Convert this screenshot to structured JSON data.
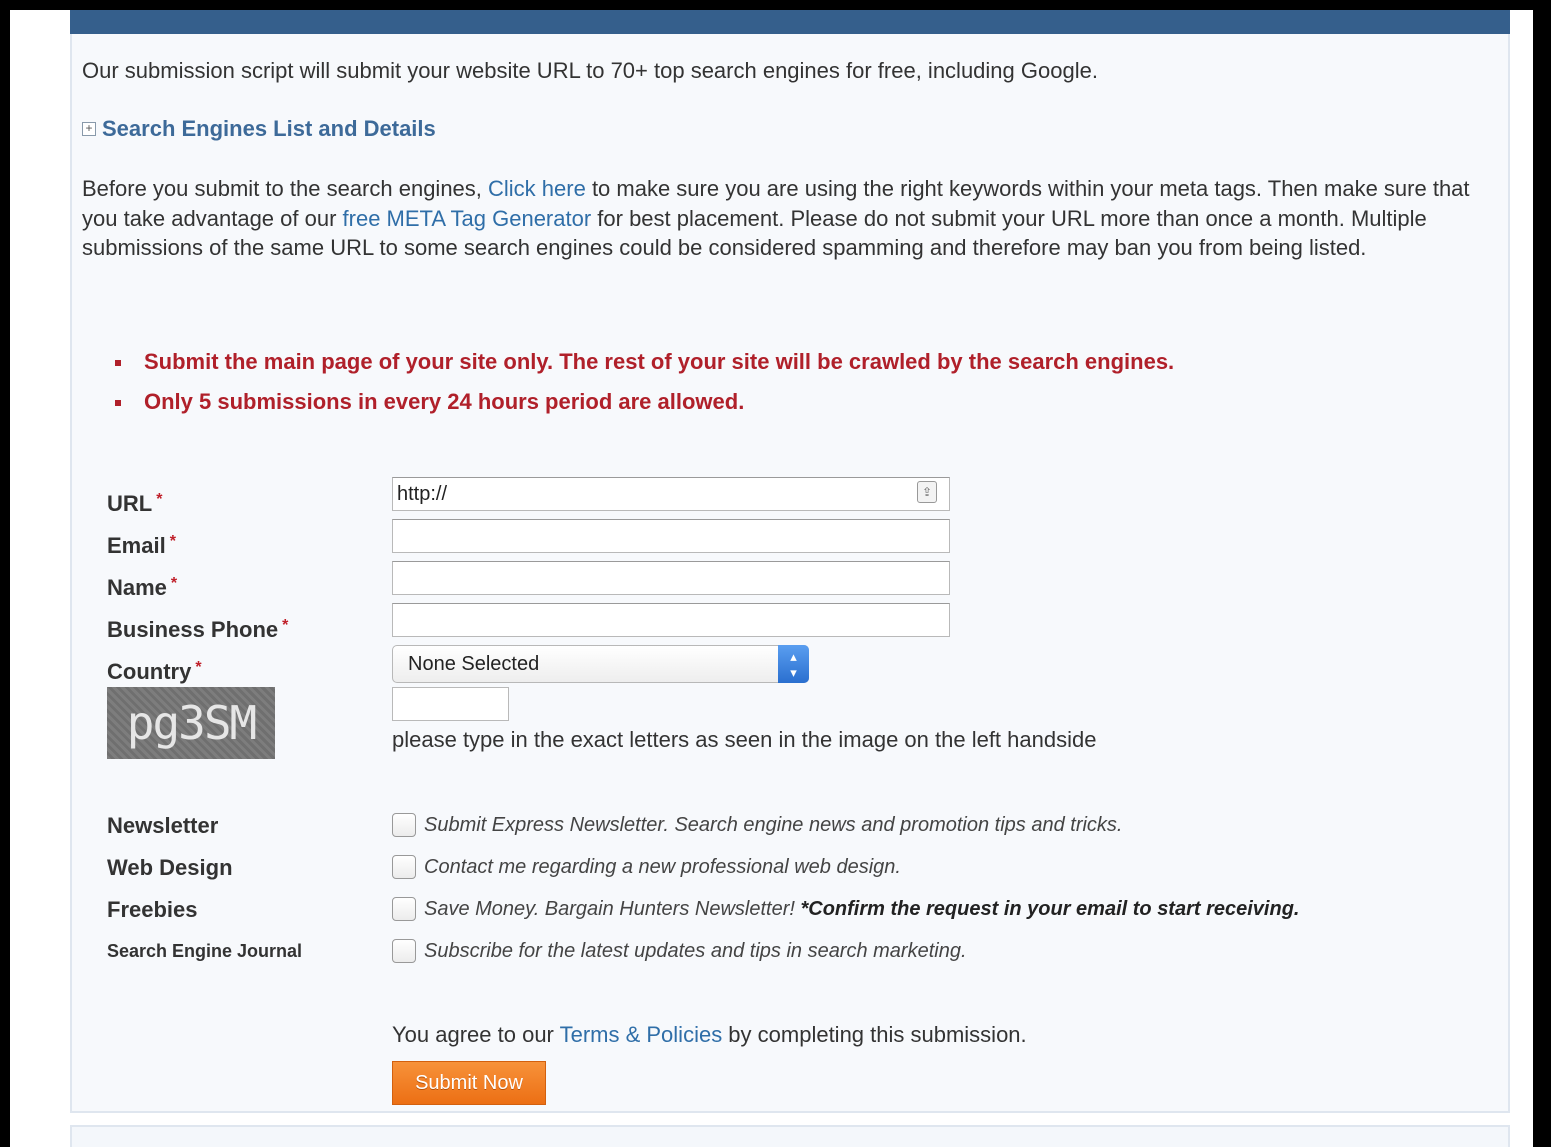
{
  "intro": "Our submission script will submit your website URL to 70+ top search engines for free, including Google.",
  "toggle_label": "Search Engines List and Details",
  "paragraph": {
    "part1": "Before you submit to the search engines, ",
    "link1": "Click here",
    "part2": " to make sure you are using the right keywords within your meta tags. Then make sure that you take advantage of our ",
    "link2": "free META Tag Generator",
    "part3": " for best placement. Please do not submit your URL more than once a month. Multiple submissions of the same URL to some search engines could be considered spamming and therefore may ban you from being listed."
  },
  "rules": [
    "Submit the main page of your site only. The rest of your site will be crawled by the search engines.",
    "Only 5 submissions in every 24 hours period are allowed."
  ],
  "form": {
    "required_mark": "*",
    "url": {
      "label": "URL",
      "value": "http://"
    },
    "email": {
      "label": "Email",
      "value": ""
    },
    "name": {
      "label": "Name",
      "value": ""
    },
    "phone": {
      "label": "Business Phone",
      "value": ""
    },
    "country": {
      "label": "Country",
      "selected": "None Selected"
    },
    "captcha": {
      "image_text": "pg3SM",
      "hint": "please type in the exact letters as seen in the image on the left handside"
    }
  },
  "options": {
    "newsletter": {
      "label": "Newsletter",
      "text": "Submit Express Newsletter. Search engine news and promotion tips and tricks.",
      "checked": false
    },
    "web_design": {
      "label": "Web Design",
      "text": "Contact me regarding a new professional web design.",
      "checked": false
    },
    "freebies": {
      "label": "Freebies",
      "text": "Save Money. Bargain Hunters Newsletter! ",
      "bold_text": "*Confirm the request in your email to start receiving.",
      "checked": false
    },
    "sej": {
      "label": "Search Engine Journal",
      "text": "Subscribe for the latest updates and tips in search marketing.",
      "checked": false
    }
  },
  "agree": {
    "before": "You agree to our ",
    "link": "Terms & Policies",
    "after": " by completing this submission."
  },
  "submit_label": "Submit Now",
  "colors": {
    "accent": "#355f8c",
    "link": "#2f6ea8",
    "warning": "#b0202a",
    "submit": "#ec6f14"
  }
}
